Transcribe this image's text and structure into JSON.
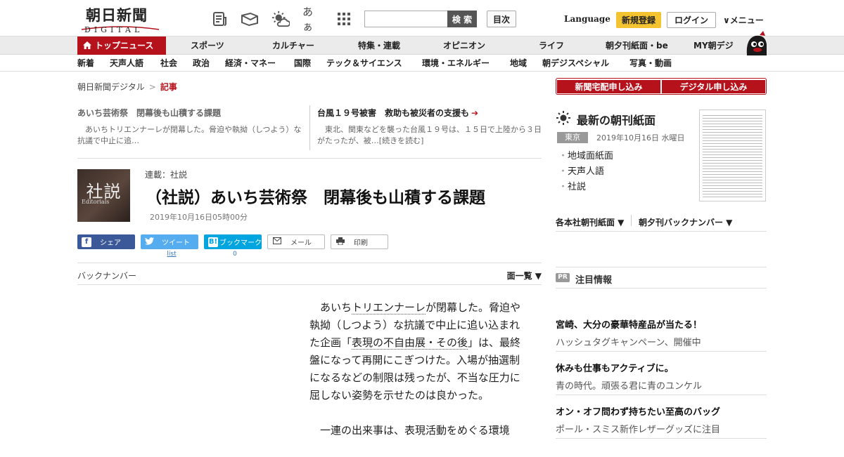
{
  "header": {
    "logo_main": "朝日新聞",
    "logo_sub": "DIGITAL",
    "text_size_glyph": "あぁ",
    "search_placeholder": "",
    "search_label": "検 索",
    "contents_label": "目次",
    "language_label": "Language",
    "register_label": "新規登録",
    "login_label": "ログイン",
    "menu_label": "∨メニュー",
    "accent_color": "#b5121b",
    "register_color": "#f3c331"
  },
  "nav_primary": [
    {
      "label": "トップニュース",
      "icon": "home-icon"
    },
    {
      "label": "スポーツ"
    },
    {
      "label": "カルチャー"
    },
    {
      "label": "特集・連載"
    },
    {
      "label": "オピニオン"
    },
    {
      "label": "ライフ"
    },
    {
      "label": "朝夕刊紙面・be"
    },
    {
      "label": "MY朝デジ"
    }
  ],
  "nav_secondary": [
    "新着",
    "天声人語",
    "社会",
    "政治",
    "経済・マネー",
    "国際",
    "テック＆サイエンス",
    "環境・エネルギー",
    "地域",
    "朝デジスペシャル",
    "写真・動画"
  ],
  "breadcrumb": {
    "home": "朝日新聞デジタル",
    "sep": ">",
    "current": "記事"
  },
  "related": [
    {
      "title": "あいち芸術祭　閉幕後も山積する課題",
      "body": "あいちトリエンナーレが閉幕した。脅迫や執拗（しつよう）な抗議で中止に追…"
    },
    {
      "title": "台風１９号被害　救助も被災者の支援も",
      "body": "東北、関東などを襲った台風１９号は、１５日で上陸から３日がたったが、被…[続きを読む]"
    }
  ],
  "article": {
    "thumb_kanji": "社説",
    "thumb_en": "Editorials",
    "serial": "連載：社説",
    "title": "（社説）あいち芸術祭　閉幕後も山積する課題",
    "date": "2019年10月16日05時00分",
    "share": {
      "facebook": "シェア",
      "twitter": "ツイート",
      "hatena": "ブックマーク",
      "mail": "メール",
      "print": "印刷",
      "twitter_count": "list",
      "hatena_count": "0"
    },
    "backnumber": "バックナンバー",
    "listview": "面一覧 ▼",
    "p1_a": "あいち",
    "p1_link1": "トリエンナーレ",
    "p1_b": "が閉幕した。脅迫や執拗（しつよう）な抗議で中止に追い込まれた企画「",
    "p1_link2": "表現の不自由展・その後",
    "p1_c": "」は、最終盤になって再開にこぎつけた。入場が抽選制になるなどの制限は残ったが、不当な圧力に屈しない姿勢を示せたのは良かった。",
    "p2": "一連の出来事は、表現活動をめぐる環境"
  },
  "sidebar": {
    "subscribe_paper": "新聞宅配申し込み",
    "subscribe_digital": "デジタル申し込み",
    "choukan_title": "最新の朝刊紙面",
    "region": "東京",
    "choukan_date": "2019年10月16日 水曜日",
    "links": [
      "地域面紙面",
      "天声人語",
      "社説"
    ],
    "dropdown1": "各本社朝刊紙面 ▼",
    "dropdown2": "朝夕刊バックナンバー ▼",
    "pr_badge": "PR",
    "pr_title": "注目情報",
    "ads": [
      {
        "title": "宮崎、大分の豪華特産品が当たる！",
        "sub": "ハッシュタグキャンペーン、開催中"
      },
      {
        "title": "休みも仕事もアクティブに。",
        "sub": "青の時代。頑張る君に青のユンケル"
      },
      {
        "title": "オン・オフ問わず持ちたい至高のバッグ",
        "sub": "ポール・スミス新作レザーグッズに注目"
      }
    ]
  }
}
